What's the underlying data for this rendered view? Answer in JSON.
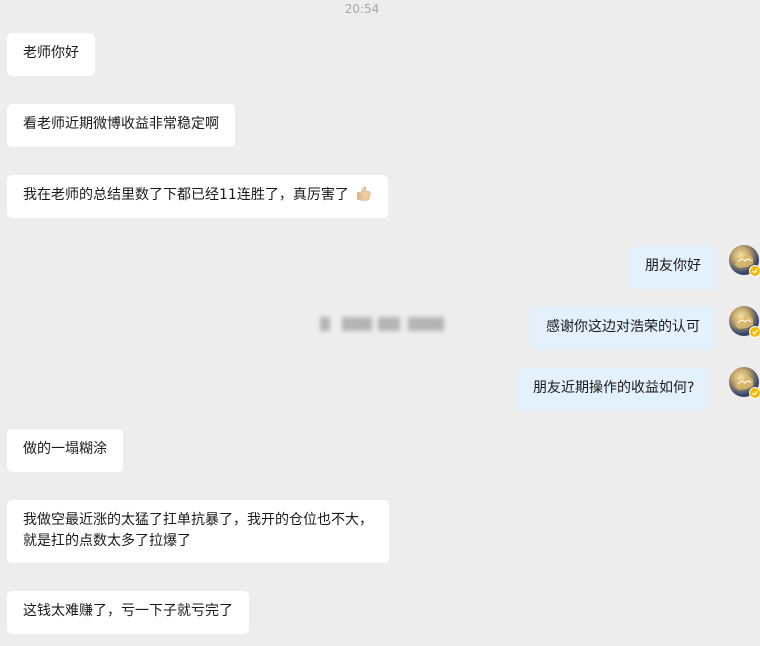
{
  "timestamp": "20:54",
  "messages": [
    {
      "side": "left",
      "text": "老师你好"
    },
    {
      "side": "left",
      "text": "看老师近期微博收益非常稳定啊"
    },
    {
      "side": "left",
      "text": "我在老师的总结里数了下都已经11连胜了，真厉害了",
      "emoji": "thumbs-up-icon"
    },
    {
      "side": "right",
      "text": "朋友你好"
    },
    {
      "side": "right",
      "text": "感谢你这边对浩荣的认可"
    },
    {
      "side": "right",
      "text": "朋友近期操作的收益如何?"
    },
    {
      "side": "left",
      "text": "做的一塌糊涂"
    },
    {
      "side": "left",
      "lines": [
        "我做空最近涨的太猛了扛单抗暴了，我开的仓位也不大，",
        "就是扛的点数太多了拉爆了"
      ]
    },
    {
      "side": "left",
      "text": "这钱太难赚了，亏一下子就亏完了"
    }
  ],
  "colors": {
    "background": "#ededed",
    "incoming_bubble": "#ffffff",
    "outgoing_bubble": "#e3f1fc",
    "verified_badge": "#f5b800"
  }
}
